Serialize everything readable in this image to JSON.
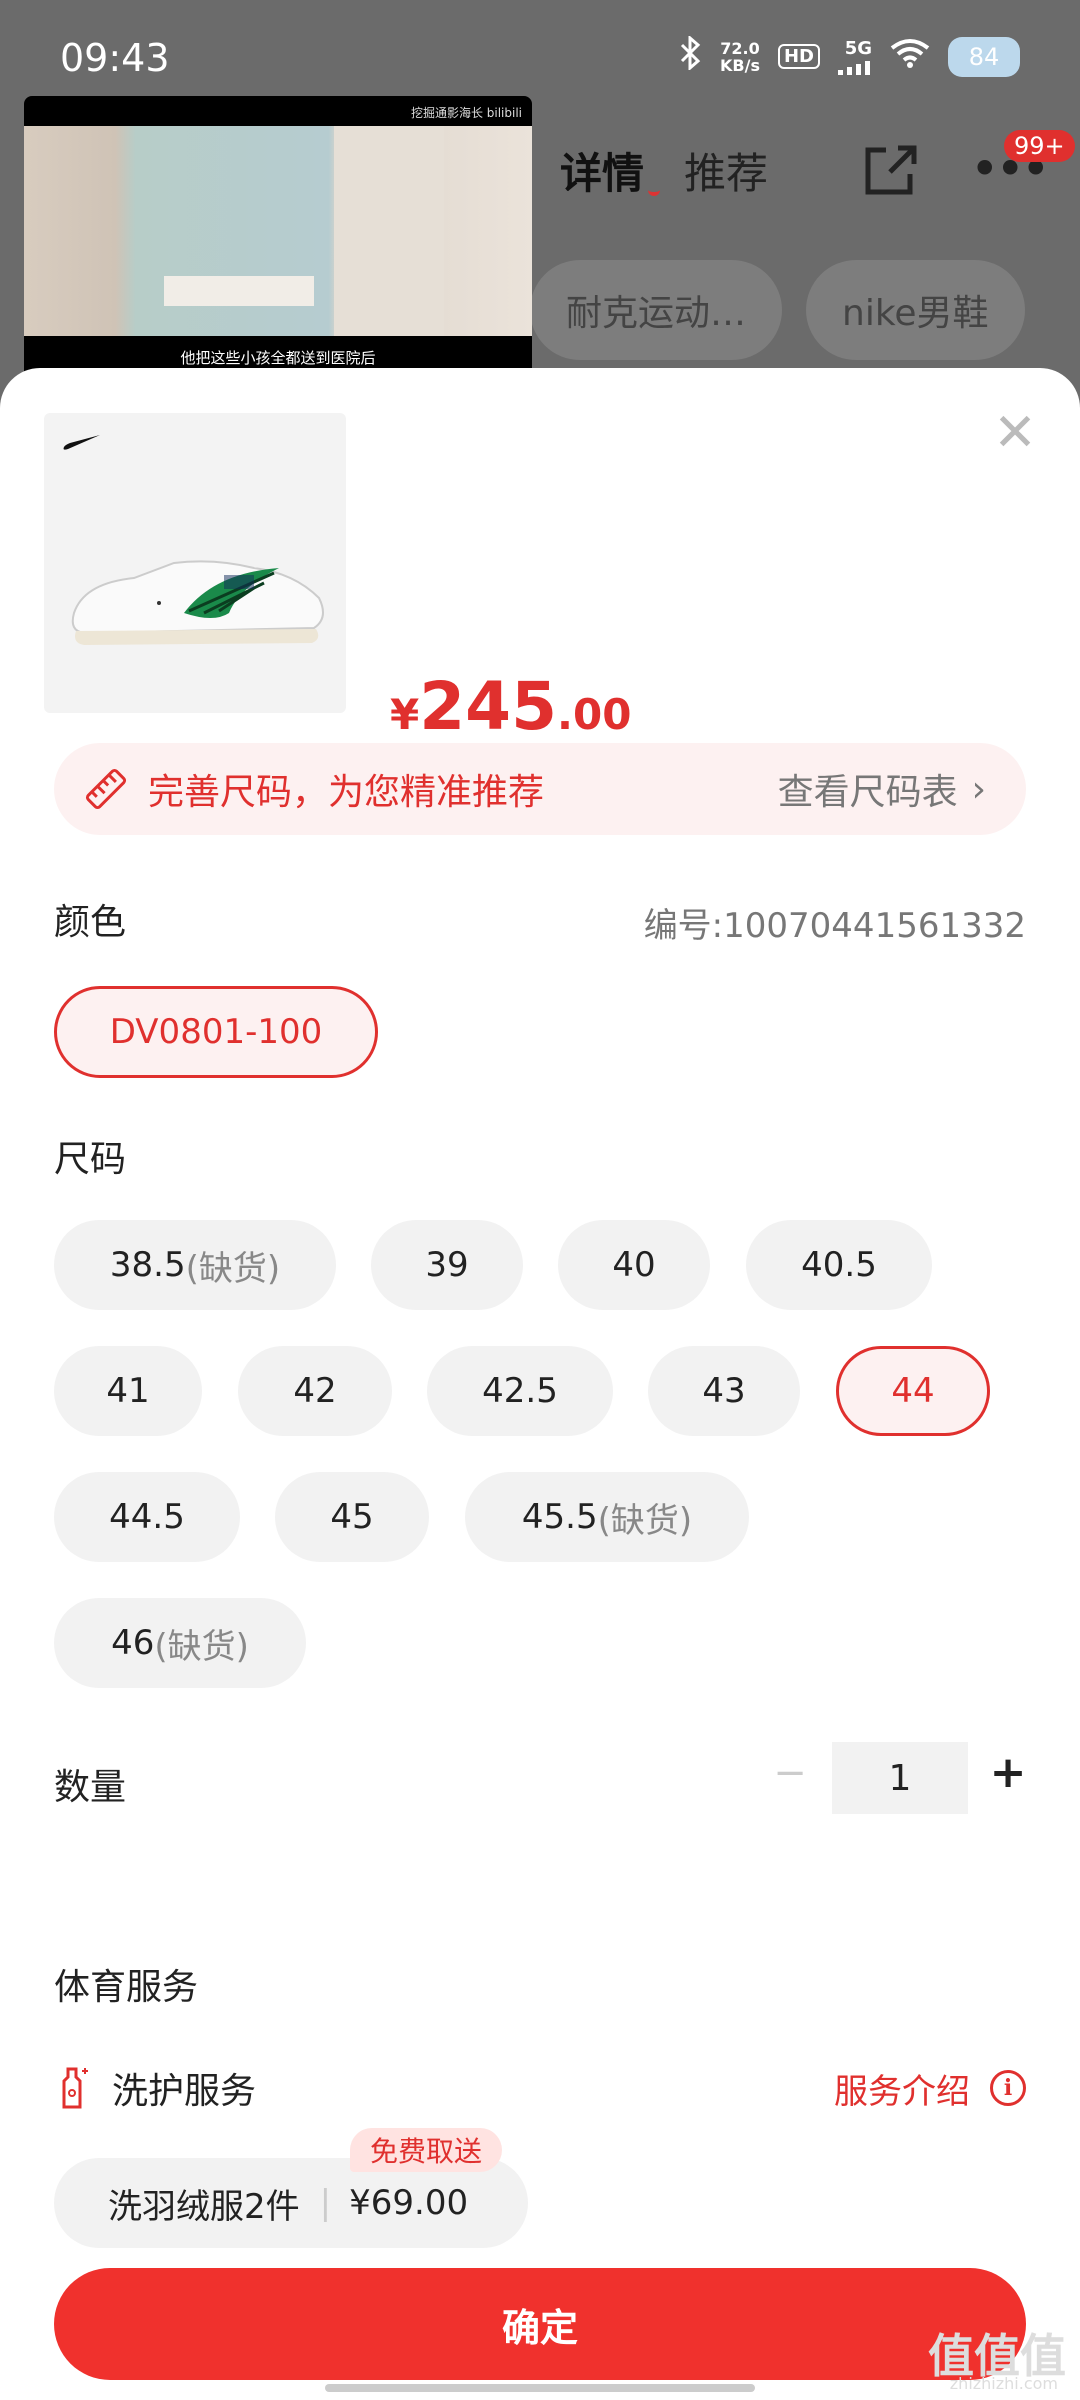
{
  "status_bar": {
    "time": "09:43",
    "speed_top": "72.0",
    "speed_unit": "KB/s",
    "hd": "HD",
    "network": "5G",
    "battery": "84"
  },
  "header": {
    "tab_detail": "详情",
    "tab_recommend": "推荐",
    "more_badge": "99+",
    "chips": [
      "耐克运动…",
      "nike男鞋"
    ]
  },
  "video": {
    "top_label": "挖掘通影海长 bilibili",
    "subtitle": "他把这些小孩全都送到医院后"
  },
  "product": {
    "price_currency": "¥",
    "price_integer": "245",
    "price_decimal": ".00"
  },
  "size_tip": {
    "text": "完善尺码，为您精准推荐",
    "link": "查看尺码表"
  },
  "color": {
    "label": "颜色",
    "code": "编号:10070441561332",
    "selected": "DV0801-100"
  },
  "size": {
    "label": "尺码",
    "options": [
      {
        "value": "38.5",
        "note": "(缺货)"
      },
      {
        "value": "39",
        "note": ""
      },
      {
        "value": "40",
        "note": ""
      },
      {
        "value": "40.5",
        "note": ""
      },
      {
        "value": "41",
        "note": ""
      },
      {
        "value": "42",
        "note": ""
      },
      {
        "value": "42.5",
        "note": ""
      },
      {
        "value": "43",
        "note": ""
      },
      {
        "value": "44",
        "note": ""
      },
      {
        "value": "44.5",
        "note": ""
      },
      {
        "value": "45",
        "note": ""
      },
      {
        "value": "45.5",
        "note": "(缺货)"
      },
      {
        "value": "46",
        "note": "(缺货)"
      }
    ],
    "selected": "44"
  },
  "quantity": {
    "label": "数量",
    "value": "1",
    "minus": "−",
    "plus": "+"
  },
  "sports_service": {
    "label": "体育服务",
    "service_name": "洗护服务",
    "service_intro": "服务介绍",
    "option_name": "洗羽绒服2件",
    "option_price": "¥69.00",
    "option_badge": "免费取送"
  },
  "confirm": {
    "label": "确定"
  },
  "watermark": {
    "main": "值值值",
    "sub": "zhizhizhi.com"
  },
  "colors": {
    "accent": "#e0302e",
    "tip_bg": "#fdf1f1",
    "chip_bg": "#f2f2f2"
  }
}
